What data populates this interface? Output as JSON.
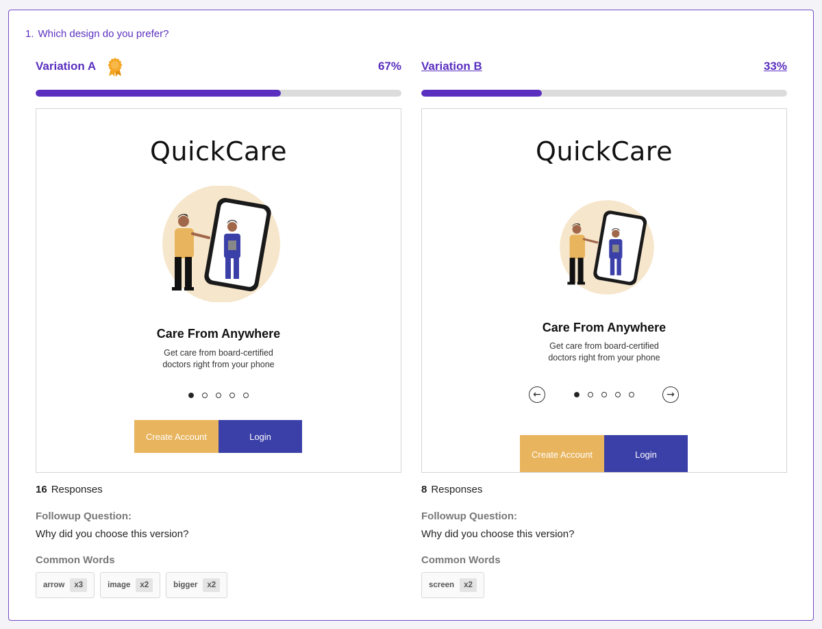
{
  "question": {
    "number": "1.",
    "text": "Which design do you prefer?"
  },
  "colors": {
    "accent": "#5a2fbf",
    "create_button": "#e8b45d",
    "login_button": "#3b40a8",
    "award": "#f2a21b"
  },
  "variations": [
    {
      "title": "Variation A",
      "winner": true,
      "percent_label": "67%",
      "percent": 67,
      "preview": {
        "brand": "QuickCare",
        "headline": "Care From Anywhere",
        "subtext_line1": "Get care from board-certified",
        "subtext_line2": "doctors right from your phone",
        "pagination_total": 5,
        "pagination_active": 1,
        "has_arrows": false,
        "create_label": "Create Account",
        "login_label": "Login"
      },
      "responses_count": "16",
      "responses_label": "Responses",
      "followup_label": "Followup Question:",
      "followup_text": "Why did you choose this version?",
      "common_words_label": "Common Words",
      "common_words": [
        {
          "word": "arrow",
          "count": "x3"
        },
        {
          "word": "image",
          "count": "x2"
        },
        {
          "word": "bigger",
          "count": "x2"
        }
      ]
    },
    {
      "title": "Variation B",
      "winner": false,
      "percent_label": "33%",
      "percent": 33,
      "preview": {
        "brand": "QuickCare",
        "headline": "Care From Anywhere",
        "subtext_line1": "Get care from board-certified",
        "subtext_line2": "doctors right from your phone",
        "pagination_total": 5,
        "pagination_active": 1,
        "has_arrows": true,
        "prev_icon": "arrow-left-icon",
        "next_icon": "arrow-right-icon",
        "create_label": "Create Account",
        "login_label": "Login"
      },
      "responses_count": "8",
      "responses_label": "Responses",
      "followup_label": "Followup Question:",
      "followup_text": "Why did you choose this version?",
      "common_words_label": "Common Words",
      "common_words": [
        {
          "word": "screen",
          "count": "x2"
        }
      ]
    }
  ]
}
